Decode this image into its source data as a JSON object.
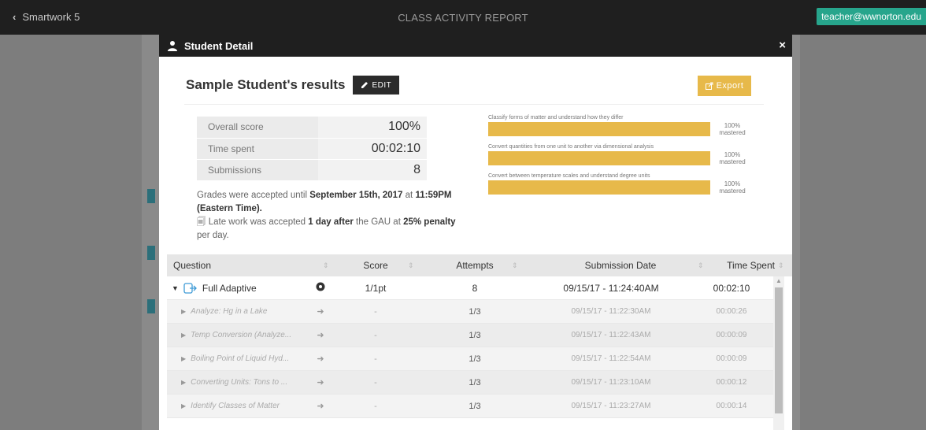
{
  "topbar": {
    "back_label": "Smartwork 5",
    "title": "CLASS ACTIVITY REPORT",
    "user_email": "teacher@wwnorton.edu"
  },
  "modal": {
    "title": "Student Detail",
    "close": "×",
    "results_title": "Sample Student's results",
    "edit_label": "EDIT",
    "export_label": "Export"
  },
  "stats": [
    {
      "label": "Overall score",
      "value": "100%"
    },
    {
      "label": "Time spent",
      "value": "00:02:10"
    },
    {
      "label": "Submissions",
      "value": "8"
    }
  ],
  "grades": {
    "line1_a": "Grades were accepted until ",
    "line1_date": "September 15th, 2017",
    "line1_b": " at ",
    "line1_time": "11:59PM",
    "line1_tz": "(Eastern Time).",
    "line2_a": "Late work was accepted ",
    "line2_days": "1 day after",
    "line2_b": " the GAU at ",
    "line2_penalty": "25% penalty",
    "line2_c": " per day."
  },
  "objectives": [
    {
      "label": "Classify forms of matter and understand how they differ",
      "pct": "100%",
      "status": "mastered",
      "fill": 1.0
    },
    {
      "label": "Convert quantities from one unit to another via dimensional analysis",
      "pct": "100%",
      "status": "mastered",
      "fill": 1.0
    },
    {
      "label": "Convert between temperature scales and understand degree units",
      "pct": "100%",
      "status": "mastered",
      "fill": 1.0
    }
  ],
  "table": {
    "headers": {
      "question": "Question",
      "score": "Score",
      "attempts": "Attempts",
      "date": "Submission Date",
      "time": "Time Spent"
    },
    "main_row": {
      "question": "Full Adaptive",
      "score": "1/1pt",
      "attempts": "8",
      "date": "09/15/17 - 11:24:40AM",
      "time": "00:02:10"
    },
    "sub_rows": [
      {
        "question": "Analyze: Hg in a Lake",
        "score": "-",
        "attempts": "1/3",
        "date": "09/15/17 - 11:22:30AM",
        "time": "00:00:26"
      },
      {
        "question": "Temp Conversion (Analyze...",
        "score": "-",
        "attempts": "1/3",
        "date": "09/15/17 - 11:22:43AM",
        "time": "00:00:09"
      },
      {
        "question": "Boiling Point of Liquid Hyd...",
        "score": "-",
        "attempts": "1/3",
        "date": "09/15/17 - 11:22:54AM",
        "time": "00:00:09"
      },
      {
        "question": "Converting Units: Tons to ...",
        "score": "-",
        "attempts": "1/3",
        "date": "09/15/17 - 11:23:10AM",
        "time": "00:00:12"
      },
      {
        "question": "Identify Classes of Matter",
        "score": "-",
        "attempts": "1/3",
        "date": "09/15/17 - 11:23:27AM",
        "time": "00:00:14"
      }
    ]
  },
  "colors": {
    "accent": "#e7b94a",
    "topbar": "#1f1f1f",
    "user_pill": "#27a58c"
  }
}
